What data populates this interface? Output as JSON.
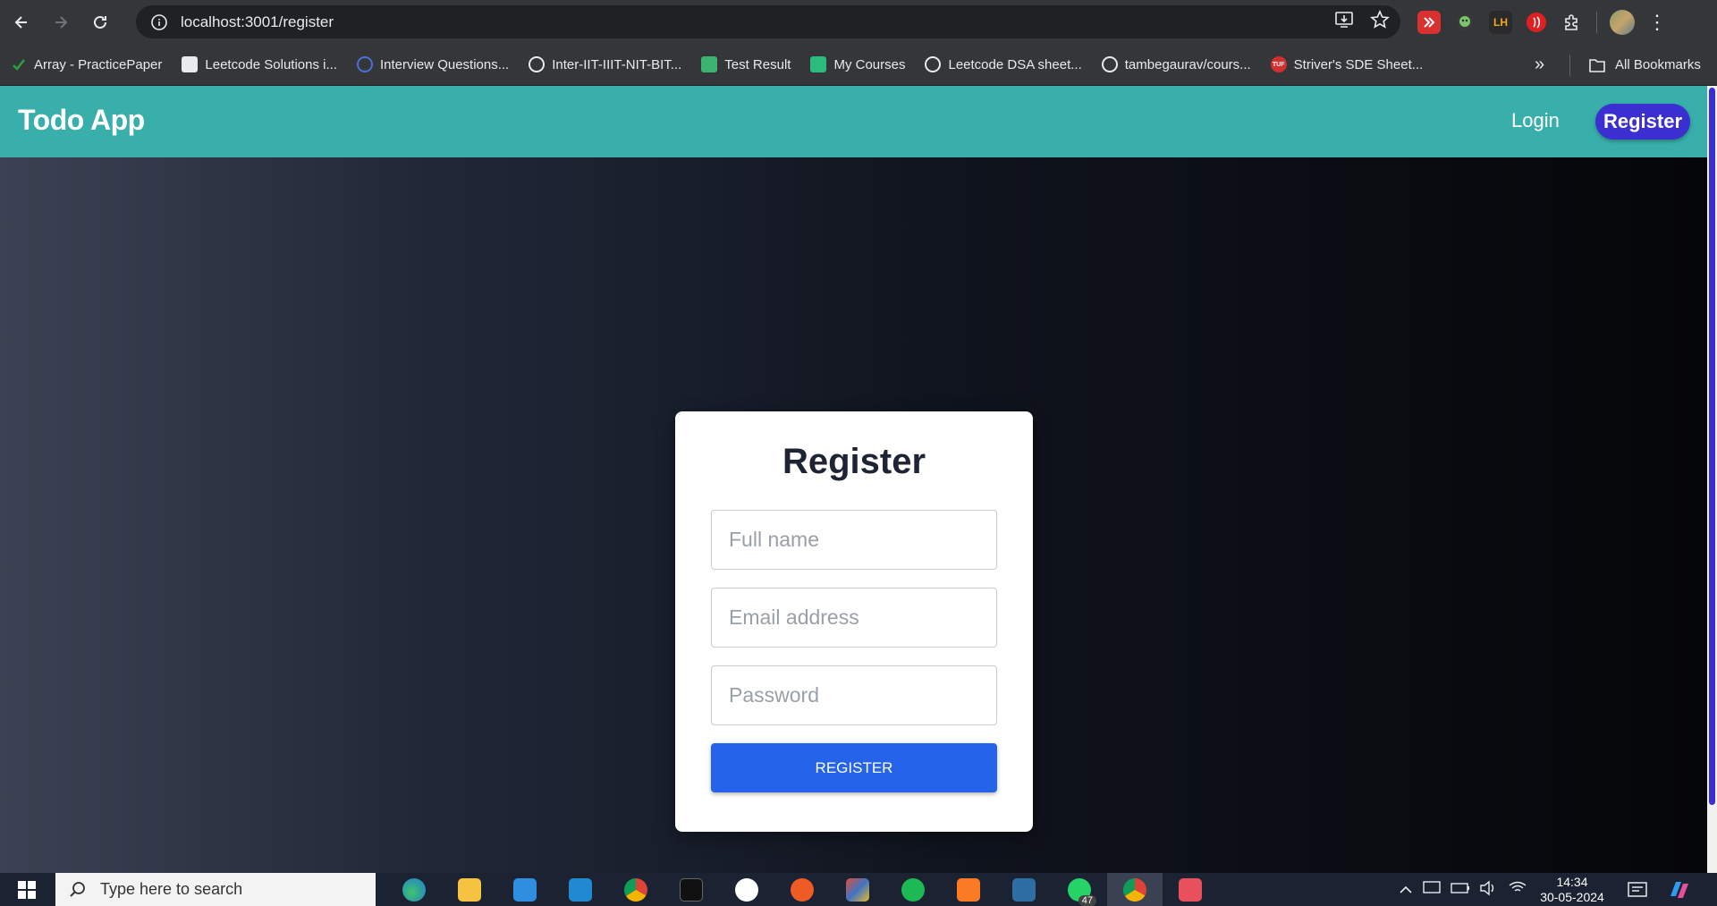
{
  "browser": {
    "url": "localhost:3001/register",
    "bookmarks": [
      {
        "label": "Array - PracticePaper",
        "icon": "checkmark-icon",
        "color": "#2ea043"
      },
      {
        "label": "Leetcode Solutions i...",
        "icon": "leetcode-doc-icon",
        "color": "#e8eaed"
      },
      {
        "label": "Interview Questions...",
        "icon": "globe-icon",
        "color": "#4a6fd1"
      },
      {
        "label": "Inter-IIT-IIIT-NIT-BIT...",
        "icon": "github-icon",
        "color": "#e8eaed"
      },
      {
        "label": "Test Result",
        "icon": "umbrella-icon",
        "color": "#3cb371"
      },
      {
        "label": "My Courses",
        "icon": "courses-icon",
        "color": "#2bbd7e"
      },
      {
        "label": "Leetcode DSA sheet...",
        "icon": "globe-icon",
        "color": "#e8eaed"
      },
      {
        "label": "tambegaurav/cours...",
        "icon": "github-icon",
        "color": "#e8eaed"
      },
      {
        "label": "Striver's SDE Sheet...",
        "icon": "tuf-icon",
        "color": "#d32f2f"
      }
    ],
    "all_bookmarks": "All Bookmarks",
    "ext_lh": "LH",
    "ext_tuf": "TUF"
  },
  "app": {
    "brand": "Todo App",
    "nav": {
      "login": "Login",
      "register": "Register"
    },
    "form": {
      "title": "Register",
      "fullname_placeholder": "Full name",
      "email_placeholder": "Email address",
      "password_placeholder": "Password",
      "submit": "REGISTER"
    },
    "colors": {
      "header": "#38afab",
      "register_pill": "#3b2fd1",
      "submit": "#2563eb"
    }
  },
  "taskbar": {
    "search_placeholder": "Type here to search",
    "whatsapp_badge": "47",
    "time": "14:34",
    "date": "30-05-2024"
  }
}
